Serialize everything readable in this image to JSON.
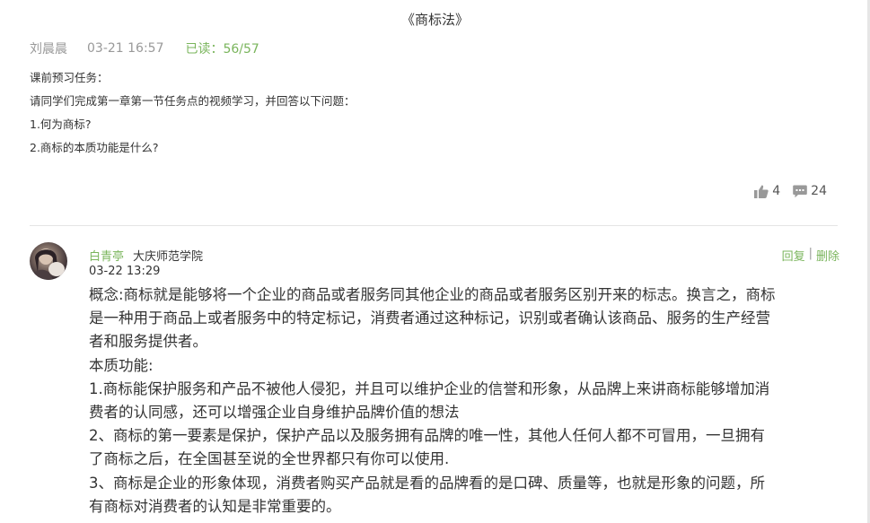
{
  "post": {
    "title": "《商标法》",
    "author": "刘晨晨",
    "timestamp": "03-21 16:57",
    "read_status": "已读：56/57",
    "body_lines": [
      "课前预习任务：",
      "请同学们完成第一章第一节任务点的视频学习，并回答以下问题：",
      "1.何为商标?",
      "2.商标的本质功能是什么?"
    ],
    "likes": "4",
    "comments": "24"
  },
  "reply": {
    "author": "白青亭",
    "school": "大庆师范学院",
    "timestamp": "03-22 13:29",
    "reply_label": "回复",
    "separator": "|",
    "delete_label": "删除",
    "content_lines": [
      "概念:商标就是能够将一个企业的商品或者服务同其他企业的商品或者服务区别开来的标志。换言之，商标",
      "是一种用于商品上或者服务中的特定标记，消费者通过这种标记，识别或者确认该商品、服务的生产经营",
      "者和服务提供者。",
      "本质功能:",
      "1.商标能保护服务和产品不被他人侵犯，并且可以维护企业的信誉和形象，从品牌上来讲商标能够增加消",
      "费者的认同感，还可以增强企业自身维护品牌价值的想法",
      "2、商标的第一要素是保护，保护产品以及服务拥有品牌的唯一性，其他人任何人都不可冒用，一旦拥有",
      "了商标之后，在全国甚至说的全世界都只有你可以使用.",
      "3、商标是企业的形象体现，消费者购买产品就是看的品牌看的是口碑、质量等，也就是形象的问题，所",
      "有商标对消费者的认知是非常重要的。"
    ]
  },
  "icons": {
    "like": "thumbs-up-icon",
    "comment": "comment-bubble-icon"
  },
  "colors": {
    "accent_green": "#7ab55c",
    "muted_gray": "#999999",
    "text": "#333333"
  }
}
